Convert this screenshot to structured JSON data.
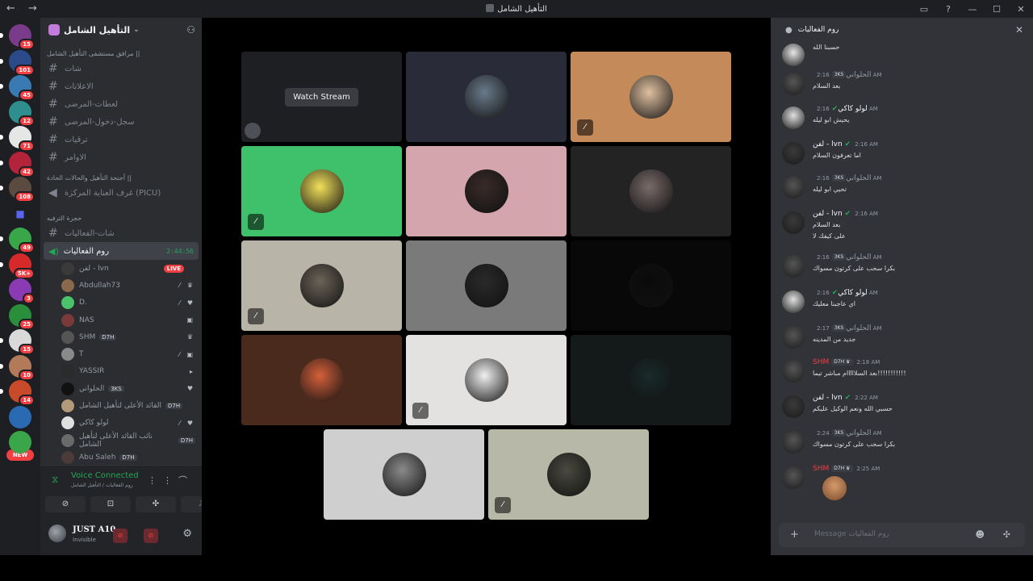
{
  "window": {
    "title": "التأهيل الشامل",
    "nav": "← →"
  },
  "servers": [
    {
      "badge": "15",
      "color": "#7a3b8a",
      "pip": true
    },
    {
      "badge": "101",
      "color": "#2a4a8a",
      "pip": true
    },
    {
      "badge": "45",
      "color": "#3a7ab3",
      "pip": true
    },
    {
      "badge": "12",
      "color": "#2f8f8f",
      "pip": false
    },
    {
      "badge": "71",
      "color": "#e6e6e6",
      "pip": true
    },
    {
      "badge": "42",
      "color": "#b3243a",
      "pip": true
    },
    {
      "badge": "108",
      "color": "#5a4a40",
      "pip": true
    },
    {
      "badge": "",
      "color": "#5865f2",
      "pip": false
    },
    {
      "badge": "49",
      "color": "#3aa64a",
      "pip": true
    },
    {
      "badge": "5K+",
      "color": "#d62a2a",
      "pip": true
    },
    {
      "badge": "3",
      "color": "#8a3ab3",
      "pip": false
    },
    {
      "badge": "25",
      "color": "#2a8f3a",
      "pip": false
    },
    {
      "badge": "15",
      "color": "#d9d9d9",
      "pip": true
    },
    {
      "badge": "10",
      "color": "#b37a5a",
      "pip": true
    },
    {
      "badge": "14",
      "color": "#c94a2a",
      "pip": true
    },
    {
      "badge": "",
      "color": "#2a6ab3",
      "pip": false
    },
    {
      "badge": "",
      "color": "#3aa64a",
      "pip": false
    }
  ],
  "rail_new": "NEW",
  "sidebar": {
    "server_name": "التأهيل الشامل",
    "cat1": "مرافق مستشفى التأهيل الشامل ||",
    "channels1": [
      "شات",
      "الاعلانات",
      "لعطات-المرضى",
      "سجل-دخول-المرضى",
      "ترقيات",
      "الاوامر"
    ],
    "cat2": "أجنحة التأهيل والحالات الحادة ||",
    "voice1": "غرف العناية المركزة (PICU)",
    "cat3": "حجرة الترفيه",
    "channel_text": "شات-الفعاليات",
    "active_voice": "روم الفعاليات",
    "active_timer": "2:44:56",
    "voice_users": [
      {
        "name": "لفن - lvn",
        "tag": "",
        "live": "LIVE",
        "icons": "",
        "color": "#3a3a3a"
      },
      {
        "name": "Abdullah73",
        "tag": "",
        "live": "",
        "icons": "⁄ ♛",
        "color": "#8a6a4a"
      },
      {
        "name": "D.",
        "tag": "",
        "live": "",
        "icons": "⁄ ♥",
        "color": "#4ac36a"
      },
      {
        "name": "NAS",
        "tag": "",
        "live": "",
        "icons": "▣",
        "color": "#7a3a3a"
      },
      {
        "name": "SHM",
        "tag": "D7H",
        "live": "",
        "icons": "♛",
        "color": "#555"
      },
      {
        "name": "T",
        "tag": "",
        "live": "",
        "icons": "⁄ ▣",
        "color": "#8a8a8a"
      },
      {
        "name": "YASSIR",
        "tag": "",
        "live": "",
        "icons": "▸",
        "color": "#2a2a2a"
      },
      {
        "name": "الحلواني",
        "tag": "3KS",
        "live": "",
        "icons": "♥",
        "color": "#111"
      },
      {
        "name": "القائد الأعلى لتأهيل الشامل",
        "tag": "D7H",
        "live": "",
        "icons": "",
        "color": "#b39a7a"
      },
      {
        "name": "لولو كاكي",
        "tag": "",
        "live": "",
        "icons": "⁄ ♥",
        "color": "#e0e0e0"
      },
      {
        "name": "نائب القائد الأعلى لتأهيل الشامل",
        "tag": "D7H",
        "live": "",
        "icons": "",
        "color": "#6a6a6a"
      },
      {
        "name": "Abu Saleh",
        "tag": "D7H",
        "live": "",
        "icons": "",
        "color": "#4a3a3a"
      }
    ]
  },
  "voice_panel": {
    "status": "Voice Connected",
    "sub": "روم الفعاليات / التأهيل الشامل"
  },
  "user_panel": {
    "name": "JUST A10",
    "status": "Invisible"
  },
  "stage": {
    "watch_label": "Watch Stream",
    "tiles": [
      {
        "bg": "#1e1f22",
        "av": "",
        "muted": false,
        "stream": true
      },
      {
        "bg": "#2a2b38",
        "av": "#6a7a8a",
        "muted": false
      },
      {
        "bg": "#c48a5a",
        "av": "#e0c0a0",
        "muted": true
      },
      {
        "bg": "#3fc06a",
        "av": "#f2e05a",
        "muted": true
      },
      {
        "bg": "#d4a5ac",
        "av": "#3a2a2a",
        "muted": false
      },
      {
        "bg": "#232323",
        "av": "#7a6a6a",
        "muted": false
      },
      {
        "bg": "#b8b4a8",
        "av": "#6a6458",
        "muted": true
      },
      {
        "bg": "#7a7a7a",
        "av": "#2a2a2a",
        "muted": false
      },
      {
        "bg": "#080808",
        "av": "#0a0a0a",
        "muted": false
      },
      {
        "bg": "#4a2a1c",
        "av": "#d4603a",
        "muted": false
      },
      {
        "bg": "#e4e2e0",
        "av": "#f0f0f0",
        "muted": true
      },
      {
        "bg": "#141a1a",
        "av": "#1a2a2a",
        "muted": false
      },
      {
        "bg": "#cfcfcf",
        "av": "#8a8a8a",
        "muted": false
      },
      {
        "bg": "#b8b8a8",
        "av": "#4a4a40",
        "muted": true
      }
    ]
  },
  "chat": {
    "header": "روم الفعاليات",
    "placeholder": "Message روم الفعاليات",
    "messages": [
      {
        "name": "",
        "badge": "",
        "time": "",
        "text": "حسبنا الله",
        "text2": "",
        "av": "#e8e8e8",
        "color": "#949ba4"
      },
      {
        "name": "الحلواني",
        "badge": "3KS",
        "time": "2:16 AM",
        "text": "بعد السلام",
        "text2": "",
        "av": "#111",
        "color": "#949ba4"
      },
      {
        "name": "لولو كاكي",
        "badge": "✔",
        "time": "2:16 AM",
        "text": "يحيش ابو ليله",
        "text2": "",
        "av": "#e0e0e0",
        "color": "#f2f3f5"
      },
      {
        "name": "لفن - lvn",
        "badge": "✔",
        "time": "2:16 AM",
        "text": "اما تعرفون السلام",
        "text2": "",
        "av": "#3a3a3a",
        "color": "#f2f3f5"
      },
      {
        "name": "الحلواني",
        "badge": "3KS",
        "time": "2:16 AM",
        "text": "تحيي ابو ليله",
        "text2": "",
        "av": "#111",
        "color": "#949ba4"
      },
      {
        "name": "لفن - lvn",
        "badge": "✔",
        "time": "2:16 AM",
        "text": "بعد السلام",
        "text2": "على كيفك لا",
        "av": "#3a3a3a",
        "color": "#f2f3f5"
      },
      {
        "name": "الحلواني",
        "badge": "3KS",
        "time": "2:16 AM",
        "text": "بكرا سحب على كرتون مسواك",
        "text2": "",
        "av": "#111",
        "color": "#949ba4"
      },
      {
        "name": "لولو كاكي",
        "badge": "✔",
        "time": "2:16 AM",
        "text": "اي عاجبنا معليك",
        "text2": "",
        "av": "#e0e0e0",
        "color": "#f2f3f5"
      },
      {
        "name": "الحلواني",
        "badge": "3KS",
        "time": "2:17 AM",
        "text": "جديد من المدينه",
        "text2": "",
        "av": "#111",
        "color": "#949ba4"
      },
      {
        "name": "SHM",
        "badge": "D7H ♛",
        "time": "2:18 AM",
        "text": "بعد السلااااام مباشر تيما!!!!!!!!!!!",
        "text2": "",
        "av": "#555",
        "color": "#f23f43"
      },
      {
        "name": "لفن - lvn",
        "badge": "✔",
        "time": "2:22 AM",
        "text": "حسبي الله ونعم الوكيل عليكم",
        "text2": "",
        "av": "#3a3a3a",
        "color": "#f2f3f5"
      },
      {
        "name": "الحلواني",
        "badge": "3KS",
        "time": "2:24 AM",
        "text": "بكرا سحب على كرتون مسواك",
        "text2": "",
        "av": "#111",
        "color": "#949ba4"
      },
      {
        "name": "SHM",
        "badge": "D7H ♛",
        "time": "2:25 AM",
        "text": "",
        "text2": "",
        "av": "#555",
        "color": "#f23f43",
        "sticker": true
      }
    ]
  }
}
